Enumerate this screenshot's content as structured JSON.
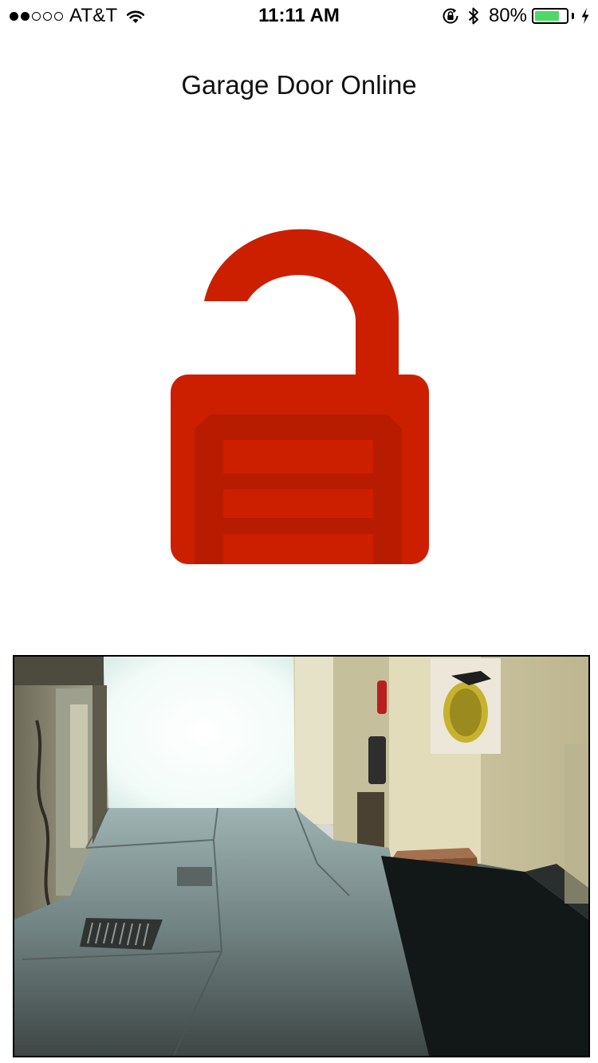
{
  "status_bar": {
    "signal_strength": 2,
    "signal_max": 5,
    "carrier": "AT&T",
    "time": "11:11 AM",
    "battery_text": "80%",
    "battery_level": 0.8,
    "battery_color": "#4cd964",
    "icons": [
      "wifi-icon",
      "rotation-lock-icon",
      "bluetooth-icon",
      "battery-icon",
      "charging-icon"
    ]
  },
  "header": {
    "title": "Garage Door Online"
  },
  "door_status": {
    "state": "unlocked",
    "icon": "open-padlock-garage-icon",
    "color": "#cc1f00"
  },
  "camera": {
    "icon": "garage-camera-feed"
  }
}
